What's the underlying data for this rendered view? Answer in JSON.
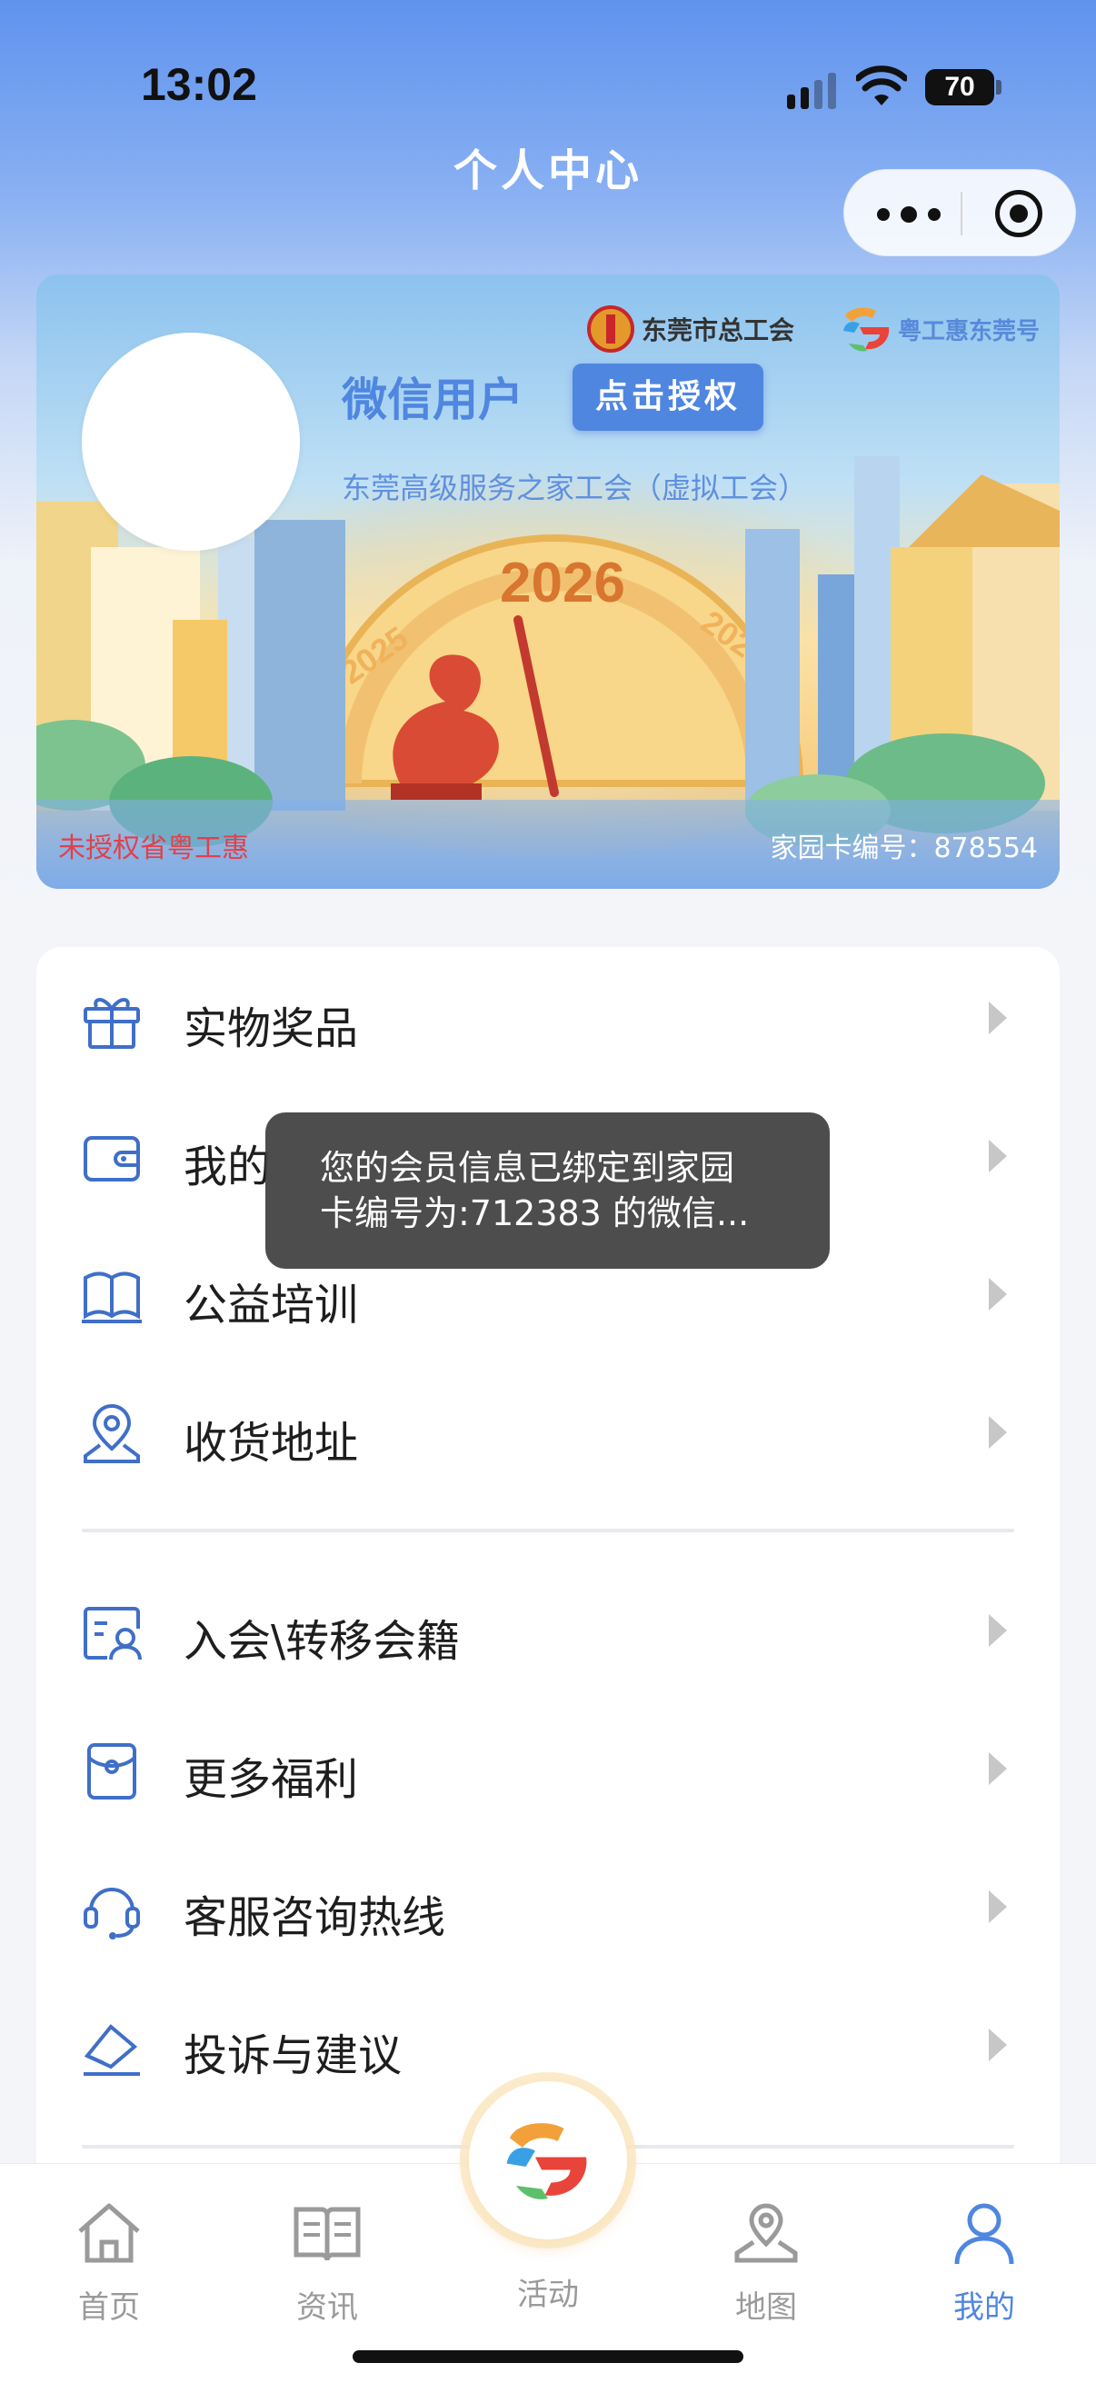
{
  "status_bar": {
    "time": "13:02",
    "battery": "70"
  },
  "nav": {
    "title": "个人中心"
  },
  "profile": {
    "logo_union_text": "东莞市总工会",
    "logo_app_text": "粤工惠东莞号",
    "username": "微信用户",
    "auth_button": "点击授权",
    "union_name": "东莞高级服务之家工会（虚拟工会）",
    "banner_year": "2026",
    "banner_year_left": "2025",
    "banner_year_right": "2027",
    "auth_status": "未授权省粤工惠",
    "card_number": "家园卡编号：878554"
  },
  "menu": {
    "group1": [
      {
        "label": "实物奖品",
        "icon": "gift-icon"
      },
      {
        "label": "我的",
        "icon": "wallet-icon"
      },
      {
        "label": "公益培训",
        "icon": "book-icon"
      },
      {
        "label": "收货地址",
        "icon": "location-icon"
      }
    ],
    "group2": [
      {
        "label": "入会\\转移会籍",
        "icon": "member-card-icon"
      },
      {
        "label": "更多福利",
        "icon": "welfare-icon"
      },
      {
        "label": "客服咨询热线",
        "icon": "headset-icon"
      },
      {
        "label": "投诉与建议",
        "icon": "feedback-icon"
      }
    ]
  },
  "toast": {
    "line1": "您的会员信息已绑定到家园",
    "line2": "卡编号为:712383 的微信..."
  },
  "tabbar": {
    "items": [
      {
        "label": "首页",
        "icon": "home-icon"
      },
      {
        "label": "资讯",
        "icon": "news-icon"
      },
      {
        "label": "活动",
        "icon": "activity-logo-icon"
      },
      {
        "label": "地图",
        "icon": "map-icon"
      },
      {
        "label": "我的",
        "icon": "profile-icon",
        "active": true
      }
    ]
  },
  "colors": {
    "accent": "#4f86e0",
    "warning": "#e0414b",
    "icon_blue": "#3f6fc8"
  }
}
